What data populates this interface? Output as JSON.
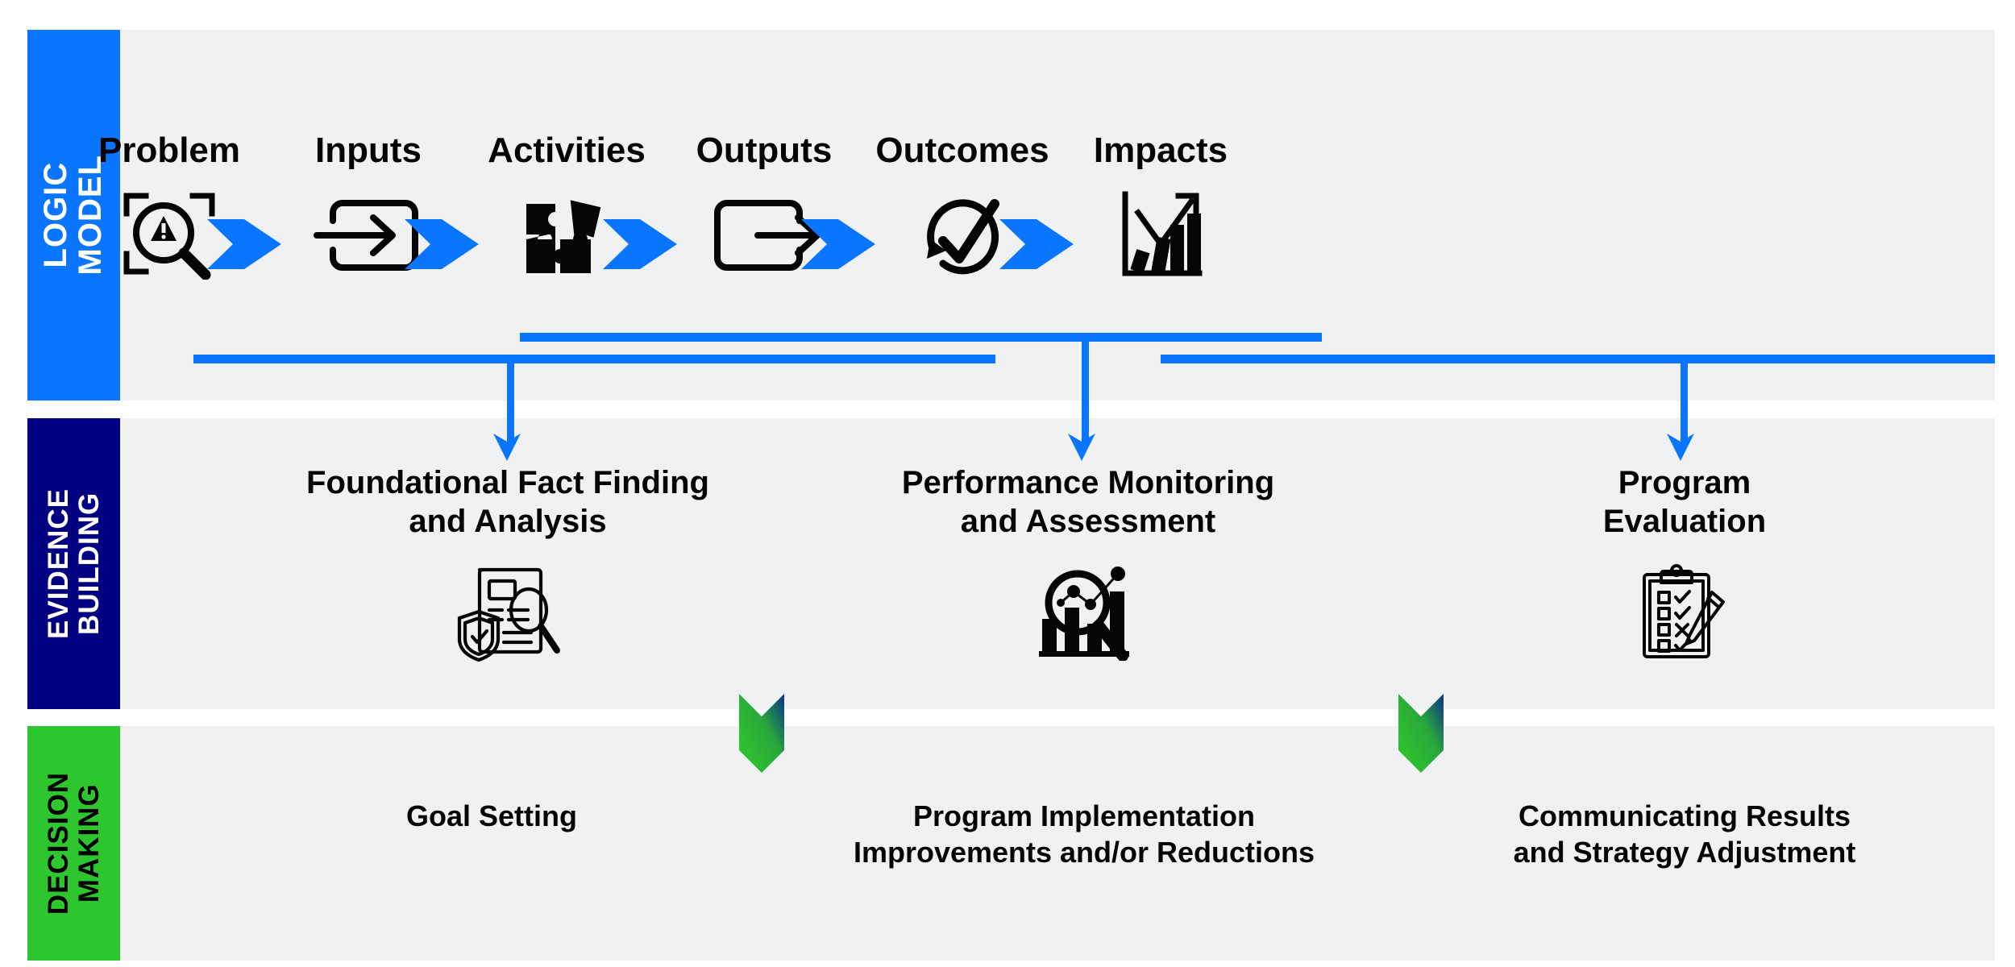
{
  "bands": {
    "logic_model": {
      "label": "LOGIC\nMODEL",
      "color": "#0a75ff",
      "text_color": "#ffffff"
    },
    "evidence_building": {
      "label": "EVIDENCE\nBUILDING",
      "color": "#000080",
      "text_color": "#ffffff"
    },
    "decision_making": {
      "label": "DECISION\nMAKING",
      "color": "#2ec62e",
      "text_color": "#000000"
    }
  },
  "logic_model": {
    "stages": [
      {
        "label": "Problem",
        "icon": "magnifier-warning-icon"
      },
      {
        "label": "Inputs",
        "icon": "arrow-into-box-icon"
      },
      {
        "label": "Activities",
        "icon": "puzzle-pieces-icon"
      },
      {
        "label": "Outputs",
        "icon": "arrow-out-of-box-icon"
      },
      {
        "label": "Outcomes",
        "icon": "circular-arrow-check-icon"
      },
      {
        "label": "Impacts",
        "icon": "growth-bar-chart-icon"
      }
    ],
    "connector_arrow_icon": "chevron-right-icon",
    "connector_color": "#0a75ff"
  },
  "evidence_building": {
    "items": [
      {
        "label": "Foundational Fact Finding\nand Analysis",
        "icon": "document-shield-magnifier-icon"
      },
      {
        "label": "Performance Monitoring\nand Assessment",
        "icon": "bar-chart-magnifier-icon"
      },
      {
        "label": "Program\nEvaluation",
        "icon": "clipboard-checklist-pencil-icon"
      }
    ]
  },
  "decision_making": {
    "items": [
      {
        "label": "Goal Setting"
      },
      {
        "label": "Program Implementation\nImprovements and/or Reductions"
      },
      {
        "label": "Communicating Results\nand Strategy Adjustment"
      }
    ],
    "ribbon_icon": "chevron-down-ribbon-icon",
    "ribbon_gradient": [
      "#0a2f8a",
      "#2ec62e"
    ]
  },
  "colors": {
    "background": "#ffffff",
    "panel": "#eff1f3",
    "accent_blue": "#0a75ff",
    "navy": "#000080",
    "green": "#2ec62e",
    "ink": "#050505"
  }
}
